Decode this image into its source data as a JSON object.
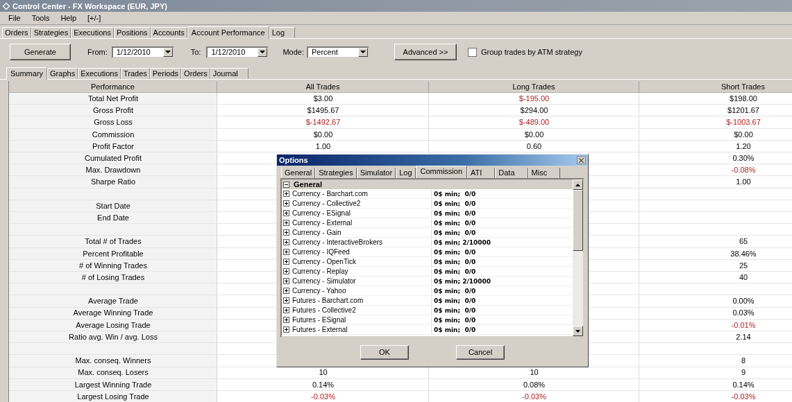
{
  "window": {
    "title": "Control Center - FX Workspace (EUR, JPY)"
  },
  "menu": [
    "File",
    "Tools",
    "Help",
    "[+/-]"
  ],
  "tabs": [
    {
      "label": "Orders",
      "selected": false
    },
    {
      "label": "Strategies",
      "selected": false
    },
    {
      "label": "Executions",
      "selected": false
    },
    {
      "label": "Positions",
      "selected": false
    },
    {
      "label": "Accounts",
      "selected": false
    },
    {
      "label": "Account Performance",
      "selected": true
    },
    {
      "label": "Log",
      "selected": false
    }
  ],
  "toolbar": {
    "generate": "Generate",
    "from_label": "From:",
    "from": "1/12/2010",
    "to_label": "To:",
    "to": "1/12/2010",
    "mode_label": "Mode:",
    "mode": "Percent",
    "advanced": "Advanced >>",
    "group_by_atm": {
      "label": "Group trades by ATM strategy",
      "checked": false
    }
  },
  "sub_tabs": [
    {
      "label": "Summary",
      "selected": true
    },
    {
      "label": "Graphs",
      "selected": false
    },
    {
      "label": "Executions",
      "selected": false
    },
    {
      "label": "Trades",
      "selected": false
    },
    {
      "label": "Periods",
      "selected": false
    },
    {
      "label": "Orders",
      "selected": false
    },
    {
      "label": "Journal",
      "selected": false
    }
  ],
  "table": {
    "columns": [
      "Performance",
      "All Trades",
      "Long Trades",
      "Short Trades"
    ],
    "rows": [
      {
        "label": "Total Net Profit",
        "all": {
          "text": "$3.00",
          "negative": false
        },
        "long": {
          "text": "$-195.00",
          "negative": true
        },
        "short": {
          "text": "$198.00",
          "negative": false
        }
      },
      {
        "label": "Gross Profit",
        "all": {
          "text": "$1495.67",
          "negative": false
        },
        "long": {
          "text": "$294.00",
          "negative": false
        },
        "short": {
          "text": "$1201.67",
          "negative": false
        }
      },
      {
        "label": "Gross Loss",
        "all": {
          "text": "$-1492.67",
          "negative": true
        },
        "long": {
          "text": "$-489.00",
          "negative": true
        },
        "short": {
          "text": "$-1003.67",
          "negative": true
        }
      },
      {
        "label": "Commission",
        "all": {
          "text": "$0.00",
          "negative": false
        },
        "long": {
          "text": "$0.00",
          "negative": false
        },
        "short": {
          "text": "$0.00",
          "negative": false
        }
      },
      {
        "label": "Profit Factor",
        "all": {
          "text": "1.00",
          "negative": false
        },
        "long": {
          "text": "0.60",
          "negative": false
        },
        "short": {
          "text": "1.20",
          "negative": false
        }
      },
      {
        "label": "Cumulated Profit",
        "short": {
          "text": "0.30%",
          "negative": false
        }
      },
      {
        "label": "Max. Drawdown",
        "short": {
          "text": "-0.08%",
          "negative": true
        }
      },
      {
        "label": "Sharpe Ratio",
        "short": {
          "text": "1.00",
          "negative": false
        }
      },
      {},
      {
        "label": "Start Date"
      },
      {
        "label": "End Date"
      },
      {},
      {
        "label": "Total # of Trades",
        "short": {
          "text": "65",
          "negative": false
        }
      },
      {
        "label": "Percent Profitable",
        "short": {
          "text": "38.46%",
          "negative": false
        }
      },
      {
        "label": "# of Winning Trades",
        "short": {
          "text": "25",
          "negative": false
        }
      },
      {
        "label": "# of Losing Trades",
        "short": {
          "text": "40",
          "negative": false
        }
      },
      {},
      {
        "label": "Average Trade",
        "short": {
          "text": "0.00%",
          "negative": false
        }
      },
      {
        "label": "Average Winning Trade",
        "short": {
          "text": "0.03%",
          "negative": false
        }
      },
      {
        "label": "Average Losing Trade",
        "short": {
          "text": "-0.01%",
          "negative": true
        }
      },
      {
        "label": "Ratio avg. Win / avg. Loss",
        "short": {
          "text": "2.14",
          "negative": false
        }
      },
      {},
      {
        "label": "Max. conseq. Winners",
        "short": {
          "text": "8",
          "negative": false
        }
      },
      {
        "label": "Max. conseq. Losers",
        "all": {
          "text": "10",
          "negative": false
        },
        "long": {
          "text": "10",
          "negative": false
        },
        "short": {
          "text": "9",
          "negative": false
        }
      },
      {
        "label": "Largest Winning Trade",
        "all": {
          "text": "0.14%",
          "negative": false
        },
        "long": {
          "text": "0.08%",
          "negative": false
        },
        "short": {
          "text": "0.14%",
          "negative": false
        }
      },
      {
        "label": "Largest Losing Trade",
        "all": {
          "text": "-0.03%",
          "negative": true
        },
        "long": {
          "text": "-0.03%",
          "negative": true
        },
        "short": {
          "text": "-0.03%",
          "negative": true
        }
      }
    ]
  },
  "dialog": {
    "title": "Options",
    "tabs": [
      {
        "label": "General",
        "selected": false
      },
      {
        "label": "Strategies",
        "selected": false
      },
      {
        "label": "Simulator",
        "selected": false
      },
      {
        "label": "Log",
        "selected": false
      },
      {
        "label": "Commission",
        "selected": true
      },
      {
        "label": "ATI",
        "selected": false
      },
      {
        "label": "Data",
        "selected": false
      },
      {
        "label": "Misc",
        "selected": false
      }
    ],
    "group": {
      "label": "General",
      "expanded": true,
      "children": [
        {
          "name": "Currency - Barchart.com",
          "value": "0$ min;  0/0",
          "expanded": false
        },
        {
          "name": "Currency - Collective2",
          "value": "0$ min;  0/0",
          "expanded": false
        },
        {
          "name": "Currency - ESignal",
          "value": "0$ min;  0/0",
          "expanded": false
        },
        {
          "name": "Currency - External",
          "value": "0$ min;  0/0",
          "expanded": false
        },
        {
          "name": "Currency - Gain",
          "value": "0$ min;  0/0",
          "expanded": false
        },
        {
          "name": "Currency - InteractiveBrokers",
          "value": "0$ min; 2/10000",
          "expanded": false
        },
        {
          "name": "Currency - IQFeed",
          "value": "0$ min;  0/0",
          "expanded": false
        },
        {
          "name": "Currency - OpenTick",
          "value": "0$ min;  0/0",
          "expanded": false
        },
        {
          "name": "Currency - Replay",
          "value": "0$ min;  0/0",
          "expanded": false
        },
        {
          "name": "Currency - Simulator",
          "value": "0$ min; 2/10000",
          "expanded": false
        },
        {
          "name": "Currency - Yahoo",
          "value": "0$ min;  0/0",
          "expanded": false
        },
        {
          "name": "Futures - Barchart.com",
          "value": "0$ min;  0/0",
          "expanded": false
        },
        {
          "name": "Futures - Collective2",
          "value": "0$ min;  0/0",
          "expanded": false
        },
        {
          "name": "Futures - ESignal",
          "value": "0$ min;  0/0",
          "expanded": false
        },
        {
          "name": "Futures - External",
          "value": "0$ min;  0/0",
          "expanded": false
        }
      ]
    },
    "buttons": [
      "OK",
      "Cancel"
    ]
  }
}
